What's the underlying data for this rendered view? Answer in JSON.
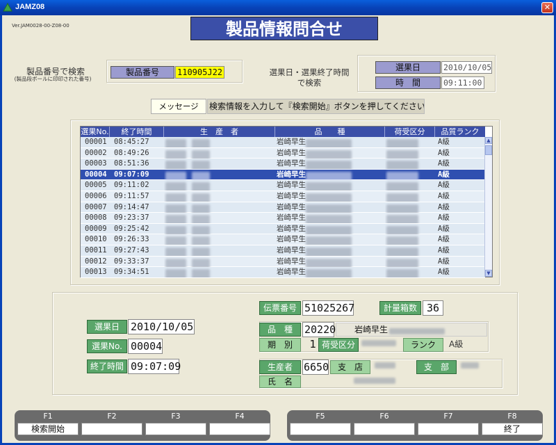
{
  "window": {
    "title": "JAMZ08",
    "close": "✕"
  },
  "version": "Ver.JAM0028-00-Z08-00",
  "page_title": "製品情報問合せ",
  "search_product": {
    "caption": "製品番号で検索",
    "subcaption": "(製品段ボールに印印された番号)",
    "label": "製品番号",
    "value": "110905J22"
  },
  "search_date": {
    "caption_line1": "選果日・選果終了時間",
    "caption_line2": "で検索",
    "date_label": "選果日",
    "date_value": "2010/10/05",
    "time_label": "時　間",
    "time_value": "09:11:00"
  },
  "message": {
    "label": "メッセージ",
    "text": "検索情報を入力して『検索開始』ボタンを押してください"
  },
  "grid": {
    "headers": [
      "選果No.",
      "終了時間",
      "生　産　者",
      "品　　種",
      "荷受区分",
      "品質ランク"
    ],
    "rows": [
      {
        "no": "00001",
        "time": "08:45:27",
        "variety": "岩崎早生",
        "rank": "A級"
      },
      {
        "no": "00002",
        "time": "08:49:26",
        "variety": "岩崎早生",
        "rank": "A級"
      },
      {
        "no": "00003",
        "time": "08:51:36",
        "variety": "岩崎早生",
        "rank": "A級"
      },
      {
        "no": "00004",
        "time": "09:07:09",
        "variety": "岩崎早生",
        "rank": "A級"
      },
      {
        "no": "00005",
        "time": "09:11:02",
        "variety": "岩崎早生",
        "rank": "A級"
      },
      {
        "no": "00006",
        "time": "09:11:57",
        "variety": "岩崎早生",
        "rank": "A級"
      },
      {
        "no": "00007",
        "time": "09:14:47",
        "variety": "岩崎早生",
        "rank": "A級"
      },
      {
        "no": "00008",
        "time": "09:23:37",
        "variety": "岩崎早生",
        "rank": "A級"
      },
      {
        "no": "00009",
        "time": "09:25:42",
        "variety": "岩崎早生",
        "rank": "A級"
      },
      {
        "no": "00010",
        "time": "09:26:33",
        "variety": "岩崎早生",
        "rank": "A級"
      },
      {
        "no": "00011",
        "time": "09:27:43",
        "variety": "岩崎早生",
        "rank": "A級"
      },
      {
        "no": "00012",
        "time": "09:33:37",
        "variety": "岩崎早生",
        "rank": "A級"
      },
      {
        "no": "00013",
        "time": "09:34:51",
        "variety": "岩崎早生",
        "rank": "A級"
      }
    ],
    "selected_index": 3
  },
  "detail": {
    "date_label": "選果日",
    "date_value": "2010/10/05",
    "no_label": "選果No.",
    "no_value": "00004",
    "end_label": "終了時間",
    "end_value": "09:07:09",
    "slip_label": "伝票番号",
    "slip_value": "51025267",
    "boxes_label": "計量箱数",
    "boxes_value": "36",
    "variety_label": "品　種",
    "variety_code": "20220",
    "variety_name": "岩崎早生",
    "period_label": "期　別",
    "period_value": "1",
    "receipt_label": "荷受区分",
    "rank_label": "ランク",
    "rank_value": "A級",
    "producer_label": "生産者",
    "producer_code": "6650",
    "branch_label": "支　店",
    "subbranch_label": "支　部",
    "name_label": "氏　名"
  },
  "fkeys": [
    {
      "key": "F1",
      "label": "検索開始"
    },
    {
      "key": "F2",
      "label": ""
    },
    {
      "key": "F3",
      "label": ""
    },
    {
      "key": "F4",
      "label": ""
    },
    {
      "key": "F5",
      "label": ""
    },
    {
      "key": "F6",
      "label": ""
    },
    {
      "key": "F7",
      "label": ""
    },
    {
      "key": "F8",
      "label": "終了"
    }
  ],
  "colors": {
    "title_blue": "#3b4fa8",
    "selection": "#2f4fb0",
    "highlight_yellow": "#ffff00",
    "label_green": "#5aa66a"
  }
}
